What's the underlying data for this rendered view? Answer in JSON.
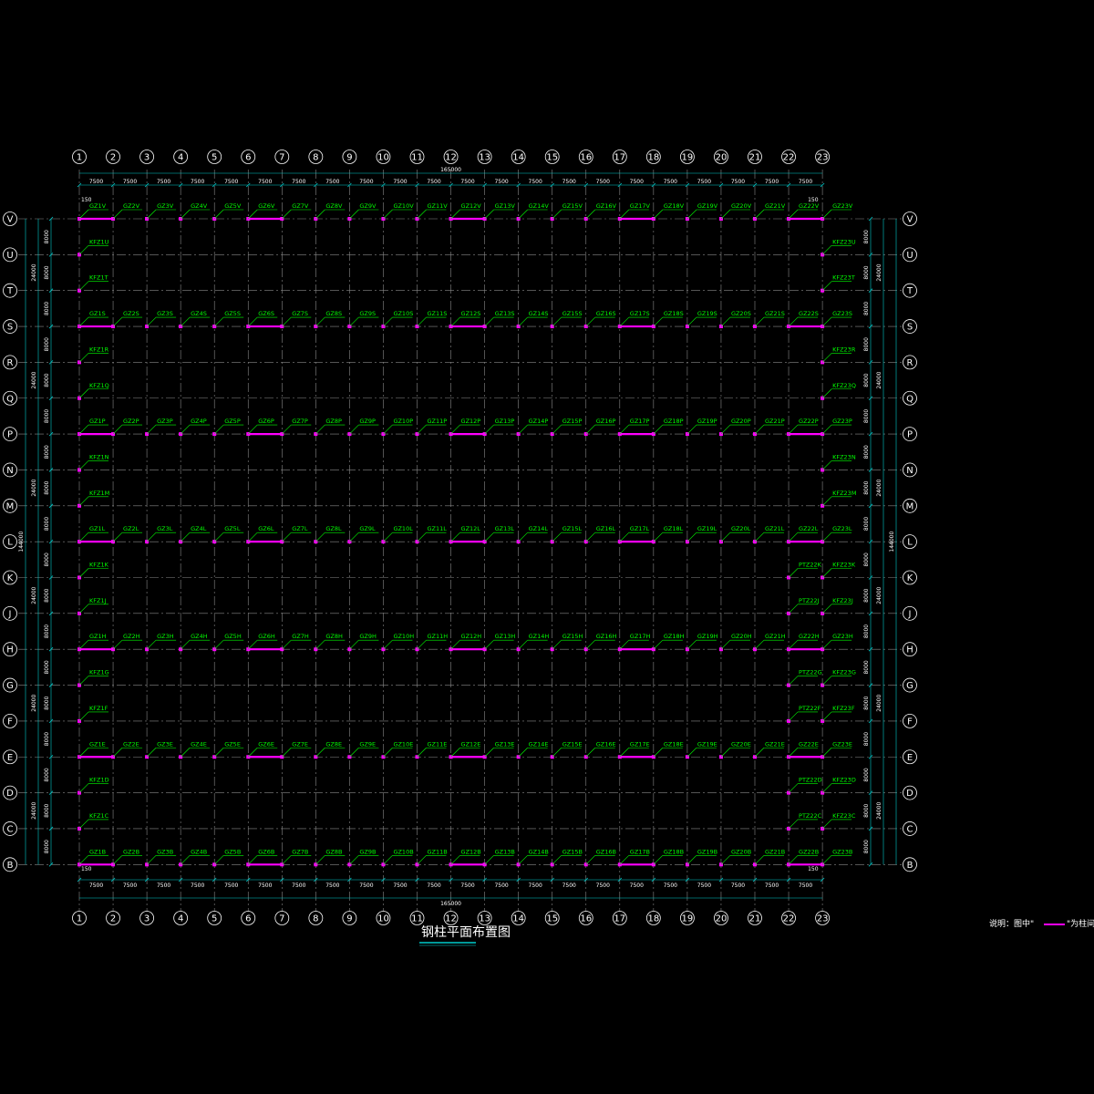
{
  "drawing": {
    "title": "钢柱平面布置图",
    "note_prefix": "说明：图中\"",
    "note_suffix": "\"为柱间支撑；",
    "colors": {
      "background": "#000000",
      "axis_line": "#888888",
      "dimension": "#00cccc",
      "column_label": "#00ff00",
      "bracing": "#ff00ff",
      "text": "#ffffff"
    }
  },
  "axes": {
    "vertical": [
      "1",
      "2",
      "3",
      "4",
      "5",
      "6",
      "7",
      "8",
      "9",
      "10",
      "11",
      "12",
      "13",
      "14",
      "15",
      "16",
      "17",
      "18",
      "19",
      "20",
      "21",
      "22",
      "23"
    ],
    "horizontal": [
      "V",
      "U",
      "T",
      "S",
      "R",
      "Q",
      "P",
      "N",
      "M",
      "L",
      "K",
      "J",
      "H",
      "G",
      "F",
      "E",
      "D",
      "C",
      "B"
    ]
  },
  "dimensions": {
    "bay": "7500",
    "total_x": "165000",
    "edge_offset": "150",
    "row_spacing": "8000",
    "group_spacing": "24000",
    "total_y": "144000"
  },
  "columns": {
    "main_rows": [
      "V",
      "S",
      "P",
      "L",
      "H",
      "E",
      "B"
    ],
    "main_prefix": "GZ",
    "end_prefix": "KFZ",
    "pt_prefix": "PTZ22",
    "pt_rows": [
      "K",
      "J",
      "G",
      "F",
      "D",
      "C"
    ]
  },
  "bracing": {
    "bays": [
      [
        6,
        7
      ],
      [
        12,
        13
      ],
      [
        17,
        18
      ]
    ],
    "end_bays": [
      [
        1,
        2
      ],
      [
        22,
        23
      ]
    ]
  }
}
